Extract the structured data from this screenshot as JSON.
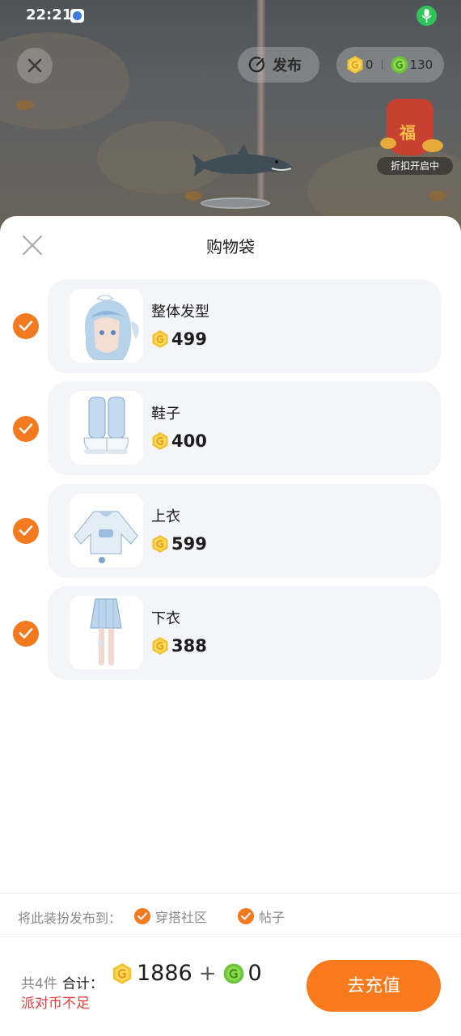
{
  "status_bar": {
    "time": "22:21"
  },
  "top_bar": {
    "publish_label": "发布",
    "gold_balance": "0",
    "green_balance": "130"
  },
  "promo": {
    "tag": "折扣开启中"
  },
  "sheet": {
    "title": "购物袋"
  },
  "items": [
    {
      "name": "整体发型",
      "price": "499",
      "checked": true,
      "thumb_icon": "hairstyle-icon"
    },
    {
      "name": "鞋子",
      "price": "400",
      "checked": true,
      "thumb_icon": "shoes-icon"
    },
    {
      "name": "上衣",
      "price": "599",
      "checked": true,
      "thumb_icon": "top-icon"
    },
    {
      "name": "下衣",
      "price": "388",
      "checked": true,
      "thumb_icon": "bottom-icon"
    }
  ],
  "publish_to": {
    "label": "将此装扮发布到：",
    "options": [
      {
        "label": "穿搭社区",
        "checked": true
      },
      {
        "label": "帖子",
        "checked": true
      }
    ]
  },
  "footer": {
    "count": "共4件",
    "total_label": "合计：",
    "gold_total": "1886",
    "plus": "+",
    "green_total": "0",
    "warning": "派对币不足",
    "button": "去充值"
  },
  "colors": {
    "accent": "#f87a1c",
    "warning": "#f23c3c",
    "gold_coin": "#f2c232",
    "green_coin": "#6cc23a"
  }
}
